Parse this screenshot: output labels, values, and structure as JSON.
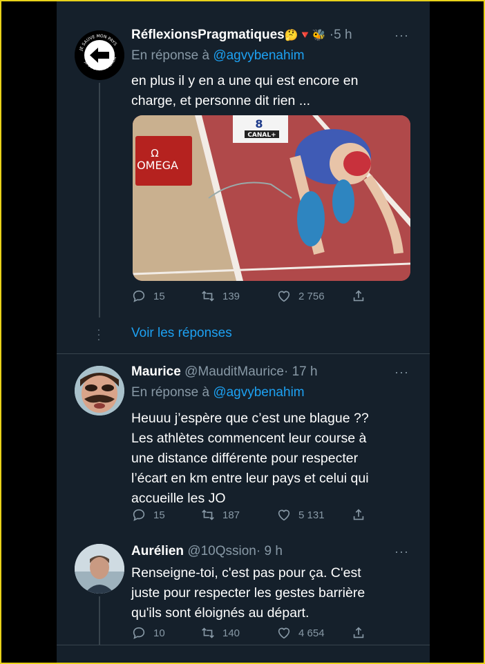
{
  "colors": {
    "background": "#15202b",
    "text": "#ffffff",
    "muted": "#8899a6",
    "link": "#1da1f2",
    "frame": "#e8d21a"
  },
  "tweets": [
    {
      "name": "RéflexionsPragmatiques",
      "emojis": "🤔🔻🐝",
      "handle": "",
      "dot": "·",
      "time": "5 h",
      "more": "···",
      "reply_prefix": "En réponse à",
      "reply_to": "@agvybenahim",
      "text_lines": [
        "en plus il y en a une qui est encore en",
        "charge, et personne dit rien ..."
      ],
      "media": {
        "brand": "OMEGA",
        "sign": "CANAL+",
        "lane": "8"
      },
      "replies": "15",
      "retweets": "139",
      "likes": "2 756"
    },
    {
      "name": "Maurice",
      "handle": "@MauditMaurice",
      "dot": "·",
      "time": "17 h",
      "more": "···",
      "reply_prefix": "En réponse à",
      "reply_to": "@agvybenahim",
      "text_lines": [
        "Heuuu j’espère que c’est une blague ??",
        "Les athlètes commencent leur course à",
        "une distance différente pour respecter",
        "l’écart en km entre leur pays et celui qui",
        "accueille les JO"
      ],
      "replies": "15",
      "retweets": "187",
      "likes": "5 131"
    },
    {
      "name": "Aurélien",
      "handle": "@10Qssion",
      "dot": "·",
      "time": "9 h",
      "more": "···",
      "text_lines": [
        "Renseigne-toi, c'est pas pour ça. C'est",
        "juste pour respecter les gestes barrière",
        "qu'ils sont éloignés au départ."
      ],
      "replies": "10",
      "retweets": "140",
      "likes": "4 654"
    }
  ],
  "see_replies": "Voir les réponses",
  "icons": [
    "reply-icon",
    "retweet-icon",
    "like-icon",
    "share-icon",
    "back-arrow-icon"
  ]
}
